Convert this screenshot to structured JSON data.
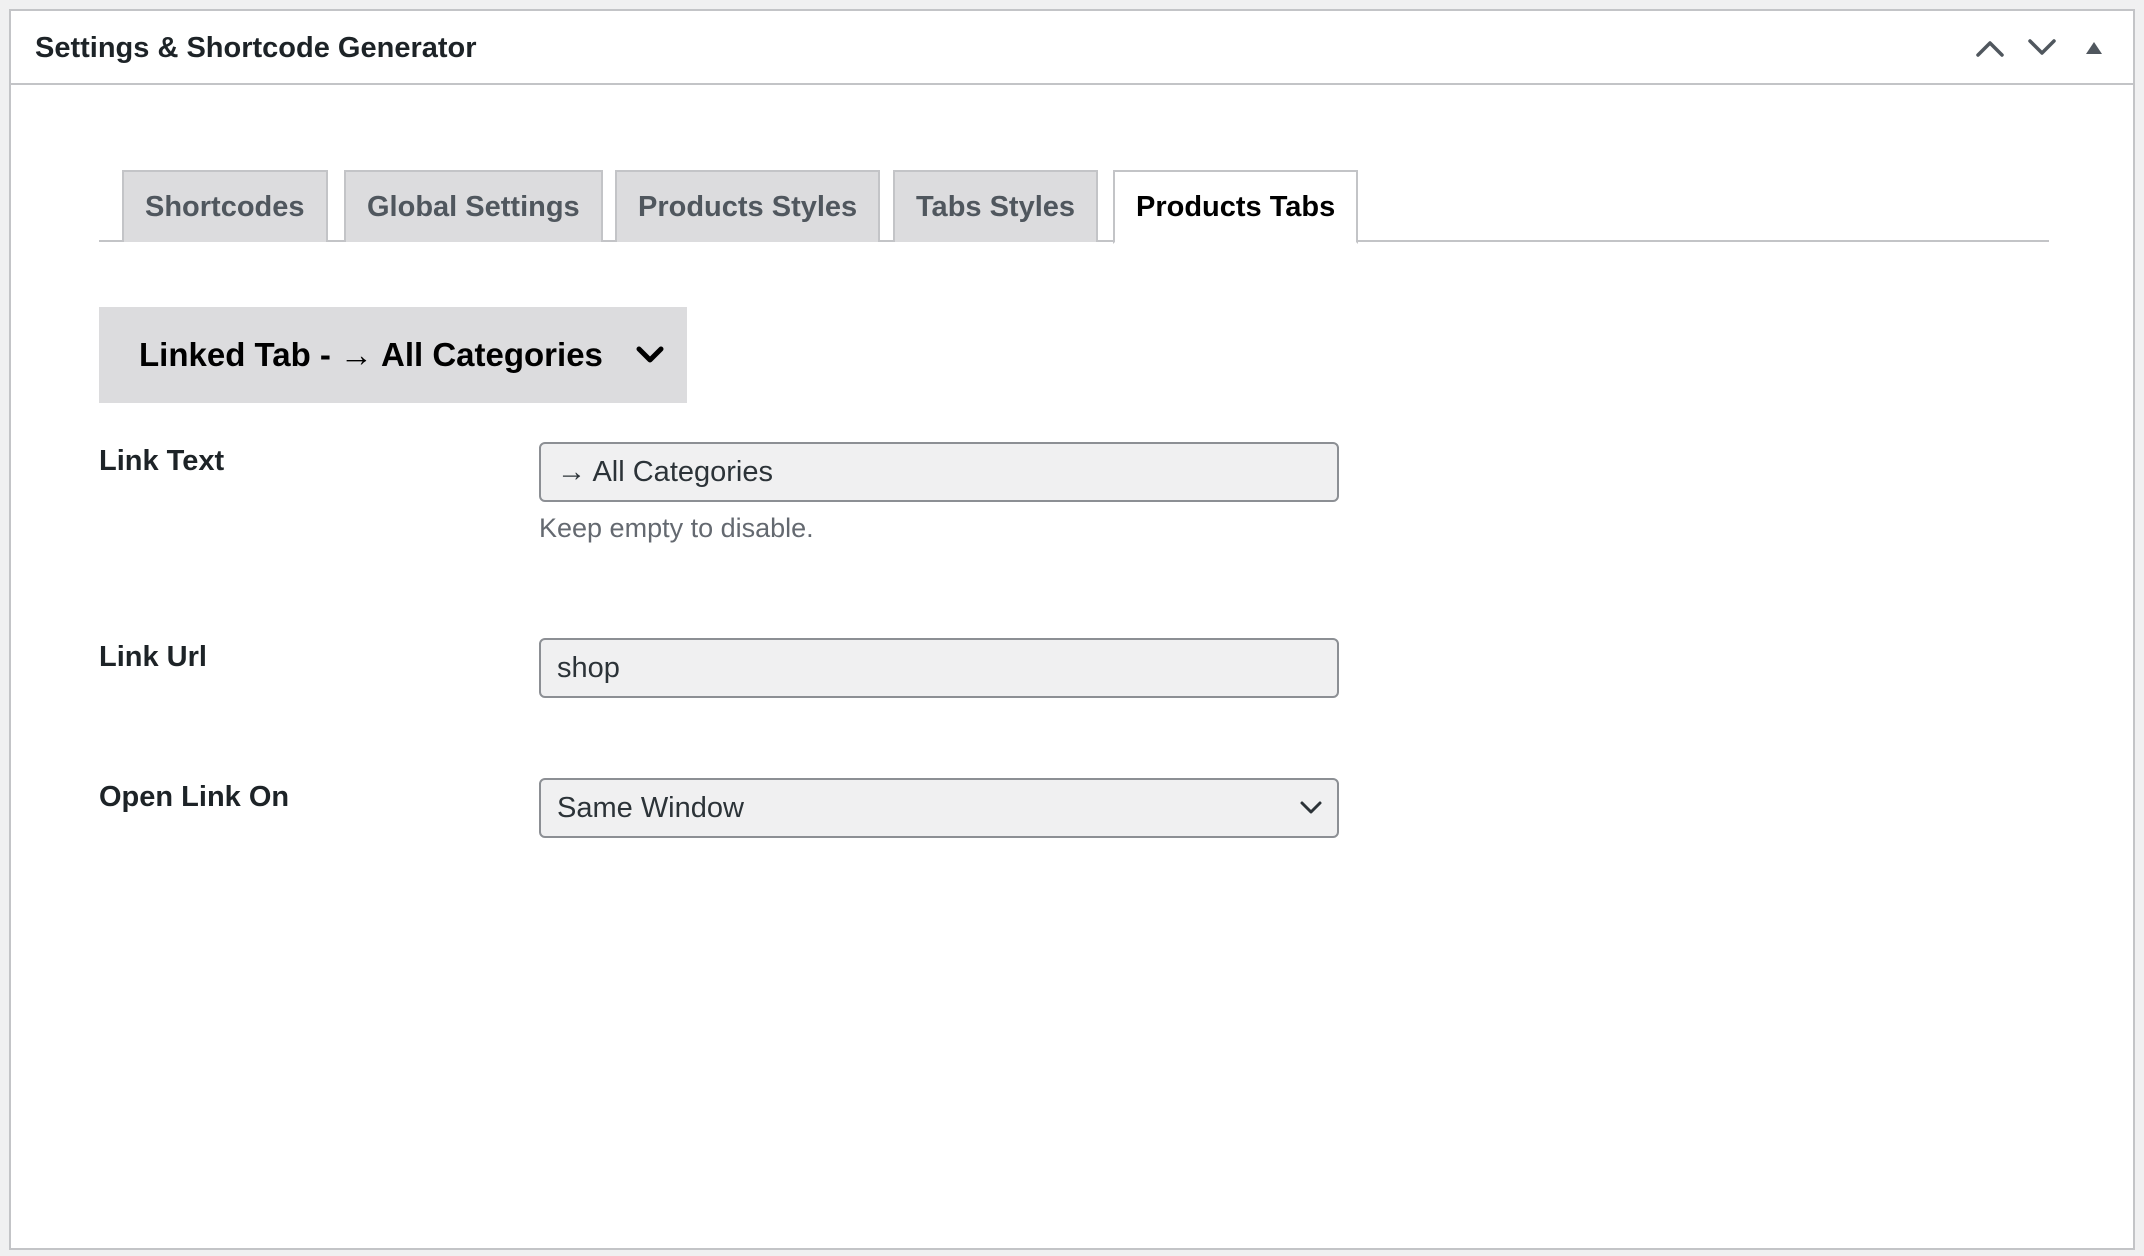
{
  "postbox": {
    "title": "Settings & Shortcode Generator",
    "actions": {
      "move_up": "chevron-up-icon",
      "move_down": "chevron-down-icon",
      "toggle": "triangle-up-icon"
    }
  },
  "tabs": [
    {
      "label": "Shortcodes",
      "active": false
    },
    {
      "label": "Global Settings",
      "active": false
    },
    {
      "label": "Products Styles",
      "active": false
    },
    {
      "label": "Tabs Styles",
      "active": false
    },
    {
      "label": "Products Tabs",
      "active": true
    }
  ],
  "accordion": {
    "title": "Linked Tab - → All Categories",
    "icon": "chevron-down-icon"
  },
  "fields": {
    "link_text": {
      "label": "Link Text",
      "value": "→ All Categories",
      "help": "Keep empty to disable."
    },
    "link_url": {
      "label": "Link Url",
      "value": "shop"
    },
    "open_link_on": {
      "label": "Open Link On",
      "selected": "Same Window"
    }
  },
  "colors": {
    "border": "#c3c4c7",
    "tab_inactive_bg": "#dcdcde",
    "input_bg": "#f0f0f1",
    "text": "#1d2327",
    "muted": "#646970"
  }
}
